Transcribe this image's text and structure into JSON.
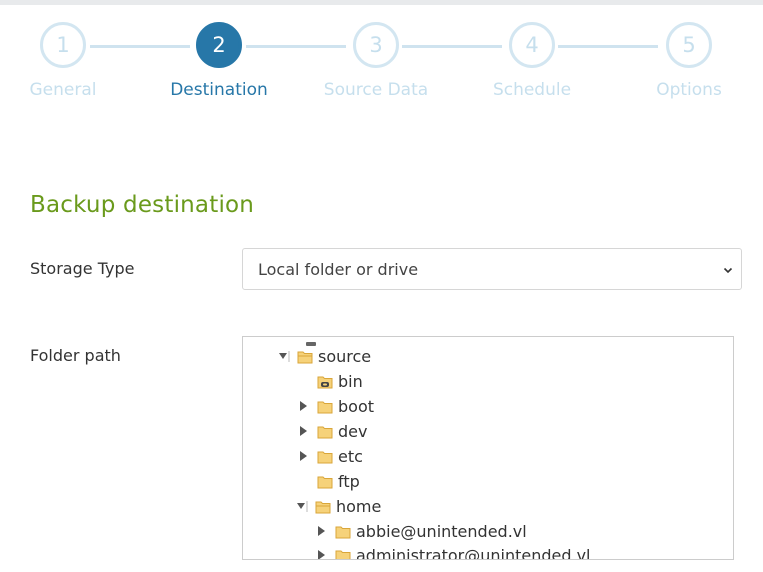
{
  "wizard": {
    "steps": [
      {
        "number": "1",
        "label": "General"
      },
      {
        "number": "2",
        "label": "Destination"
      },
      {
        "number": "3",
        "label": "Source Data"
      },
      {
        "number": "4",
        "label": "Schedule"
      },
      {
        "number": "5",
        "label": "Options"
      }
    ],
    "active_step": 2
  },
  "section": {
    "title": "Backup destination"
  },
  "storage_type": {
    "label": "Storage Type",
    "value": "Local folder or drive"
  },
  "folder_path": {
    "label": "Folder path",
    "tree": [
      {
        "label": "source",
        "state": "expanded",
        "icon": "folder-open-icon"
      },
      {
        "label": "bin",
        "state": "leaf",
        "icon": "folder-link-icon"
      },
      {
        "label": "boot",
        "state": "collapsed",
        "icon": "folder-icon"
      },
      {
        "label": "dev",
        "state": "collapsed",
        "icon": "folder-icon"
      },
      {
        "label": "etc",
        "state": "collapsed",
        "icon": "folder-icon"
      },
      {
        "label": "ftp",
        "state": "leaf",
        "icon": "folder-icon"
      },
      {
        "label": "home",
        "state": "expanded",
        "icon": "folder-open-icon"
      },
      {
        "label": "abbie@unintended.vl",
        "state": "collapsed",
        "icon": "folder-icon"
      },
      {
        "label": "administrator@unintended.vl",
        "state": "collapsed",
        "icon": "folder-icon"
      }
    ]
  },
  "colors": {
    "accent": "#2777a8",
    "inactive_step": "#c6dfed",
    "section_title": "#6a9a1c",
    "folder": "#f2c45a"
  }
}
